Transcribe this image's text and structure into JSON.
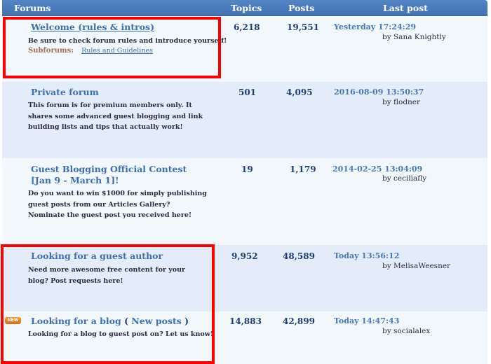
{
  "header": {
    "forums": "Forums",
    "topics": "Topics",
    "posts": "Posts",
    "last_post": "Last post"
  },
  "forums": [
    {
      "title": "Welcome (rules & intros)",
      "description": "Be sure to check forum rules and introduce yourself!",
      "subforums_label": "Subforums:",
      "subforum_link": "Rules and Guidelines",
      "topics": "6,218",
      "posts": "19,551",
      "last_post_time": "Yesterday 17:24:29",
      "last_post_by": "by Sana Knightly"
    },
    {
      "title": "Private forum",
      "description": "This forum is for premium members only. It shares some advanced guest blogging and link building lists and tips that actually work!",
      "topics": "501",
      "posts": "4,095",
      "last_post_time": "2016-08-09 13:50:37",
      "last_post_by": "by flodner"
    },
    {
      "title": "Guest Blogging Official Contest [Jan 9 - March 1]!",
      "description": "Do you want to win $1000 for simply publishing guest posts from our Articles Gallery? Nominate the guest post you received here!",
      "topics": "19",
      "posts": "1,179",
      "last_post_time": "2014-02-25 13:04:09",
      "last_post_by": "by ceciliafly"
    },
    {
      "title": "Looking for a guest author",
      "description": "Need more awesome free content for your blog? Post requests here!",
      "topics": "9,952",
      "posts": "48,589",
      "last_post_time": "Today 13:56:12",
      "last_post_by": "by MelisaWeesner"
    },
    {
      "title": "Looking for a blog",
      "badge": "NEW",
      "paren_open": "(",
      "new_posts_label": "New posts",
      "paren_close": ")",
      "description": "Looking for a blog to guest post on? Let us know!",
      "topics": "14,883",
      "posts": "42,899",
      "last_post_time": "Today 14:47:43",
      "last_post_by": "by socialalex"
    }
  ],
  "colors": {
    "header_bg": "#4a7ab8",
    "row_light": "#f2f7fc",
    "row_dark": "#e4ecfa",
    "link": "#3f6fae",
    "highlight": "#ff0000",
    "new_badge": "#e8841f"
  }
}
